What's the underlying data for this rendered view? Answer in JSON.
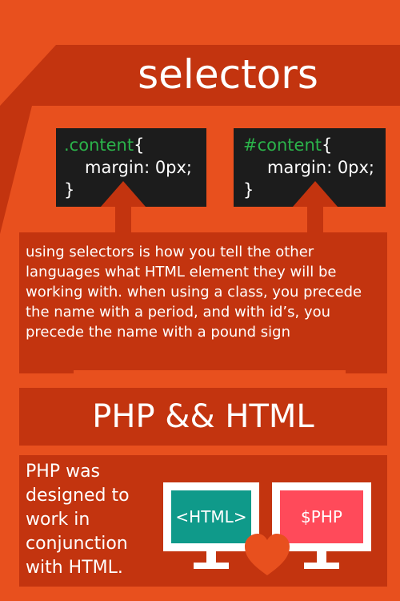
{
  "title": "selectors",
  "code_left": {
    "selector": ".content",
    "open": "{",
    "property": "margin: 0px;",
    "close": "}"
  },
  "code_right": {
    "selector": "#content",
    "open": "{",
    "property": "margin: 0px;",
    "close": "}"
  },
  "description": "using selectors is how you tell the other languages what HTML element they will be working with. when using a class, you precede the name with a period, and with id’s, you precede the name with a pound sign",
  "php_title": "PHP && HTML",
  "php_text": "PHP was designed to work in conjunction with HTML.",
  "monitor_html": "<HTML>",
  "monitor_php": "$PHP",
  "colors": {
    "background": "#e8501e",
    "accent": "#c3340f",
    "code_bg": "#1c1c1c",
    "selector": "#2bb34a",
    "html_screen": "#0f9a8a",
    "php_screen": "#ff4a5a",
    "heart": "#e8501e"
  }
}
